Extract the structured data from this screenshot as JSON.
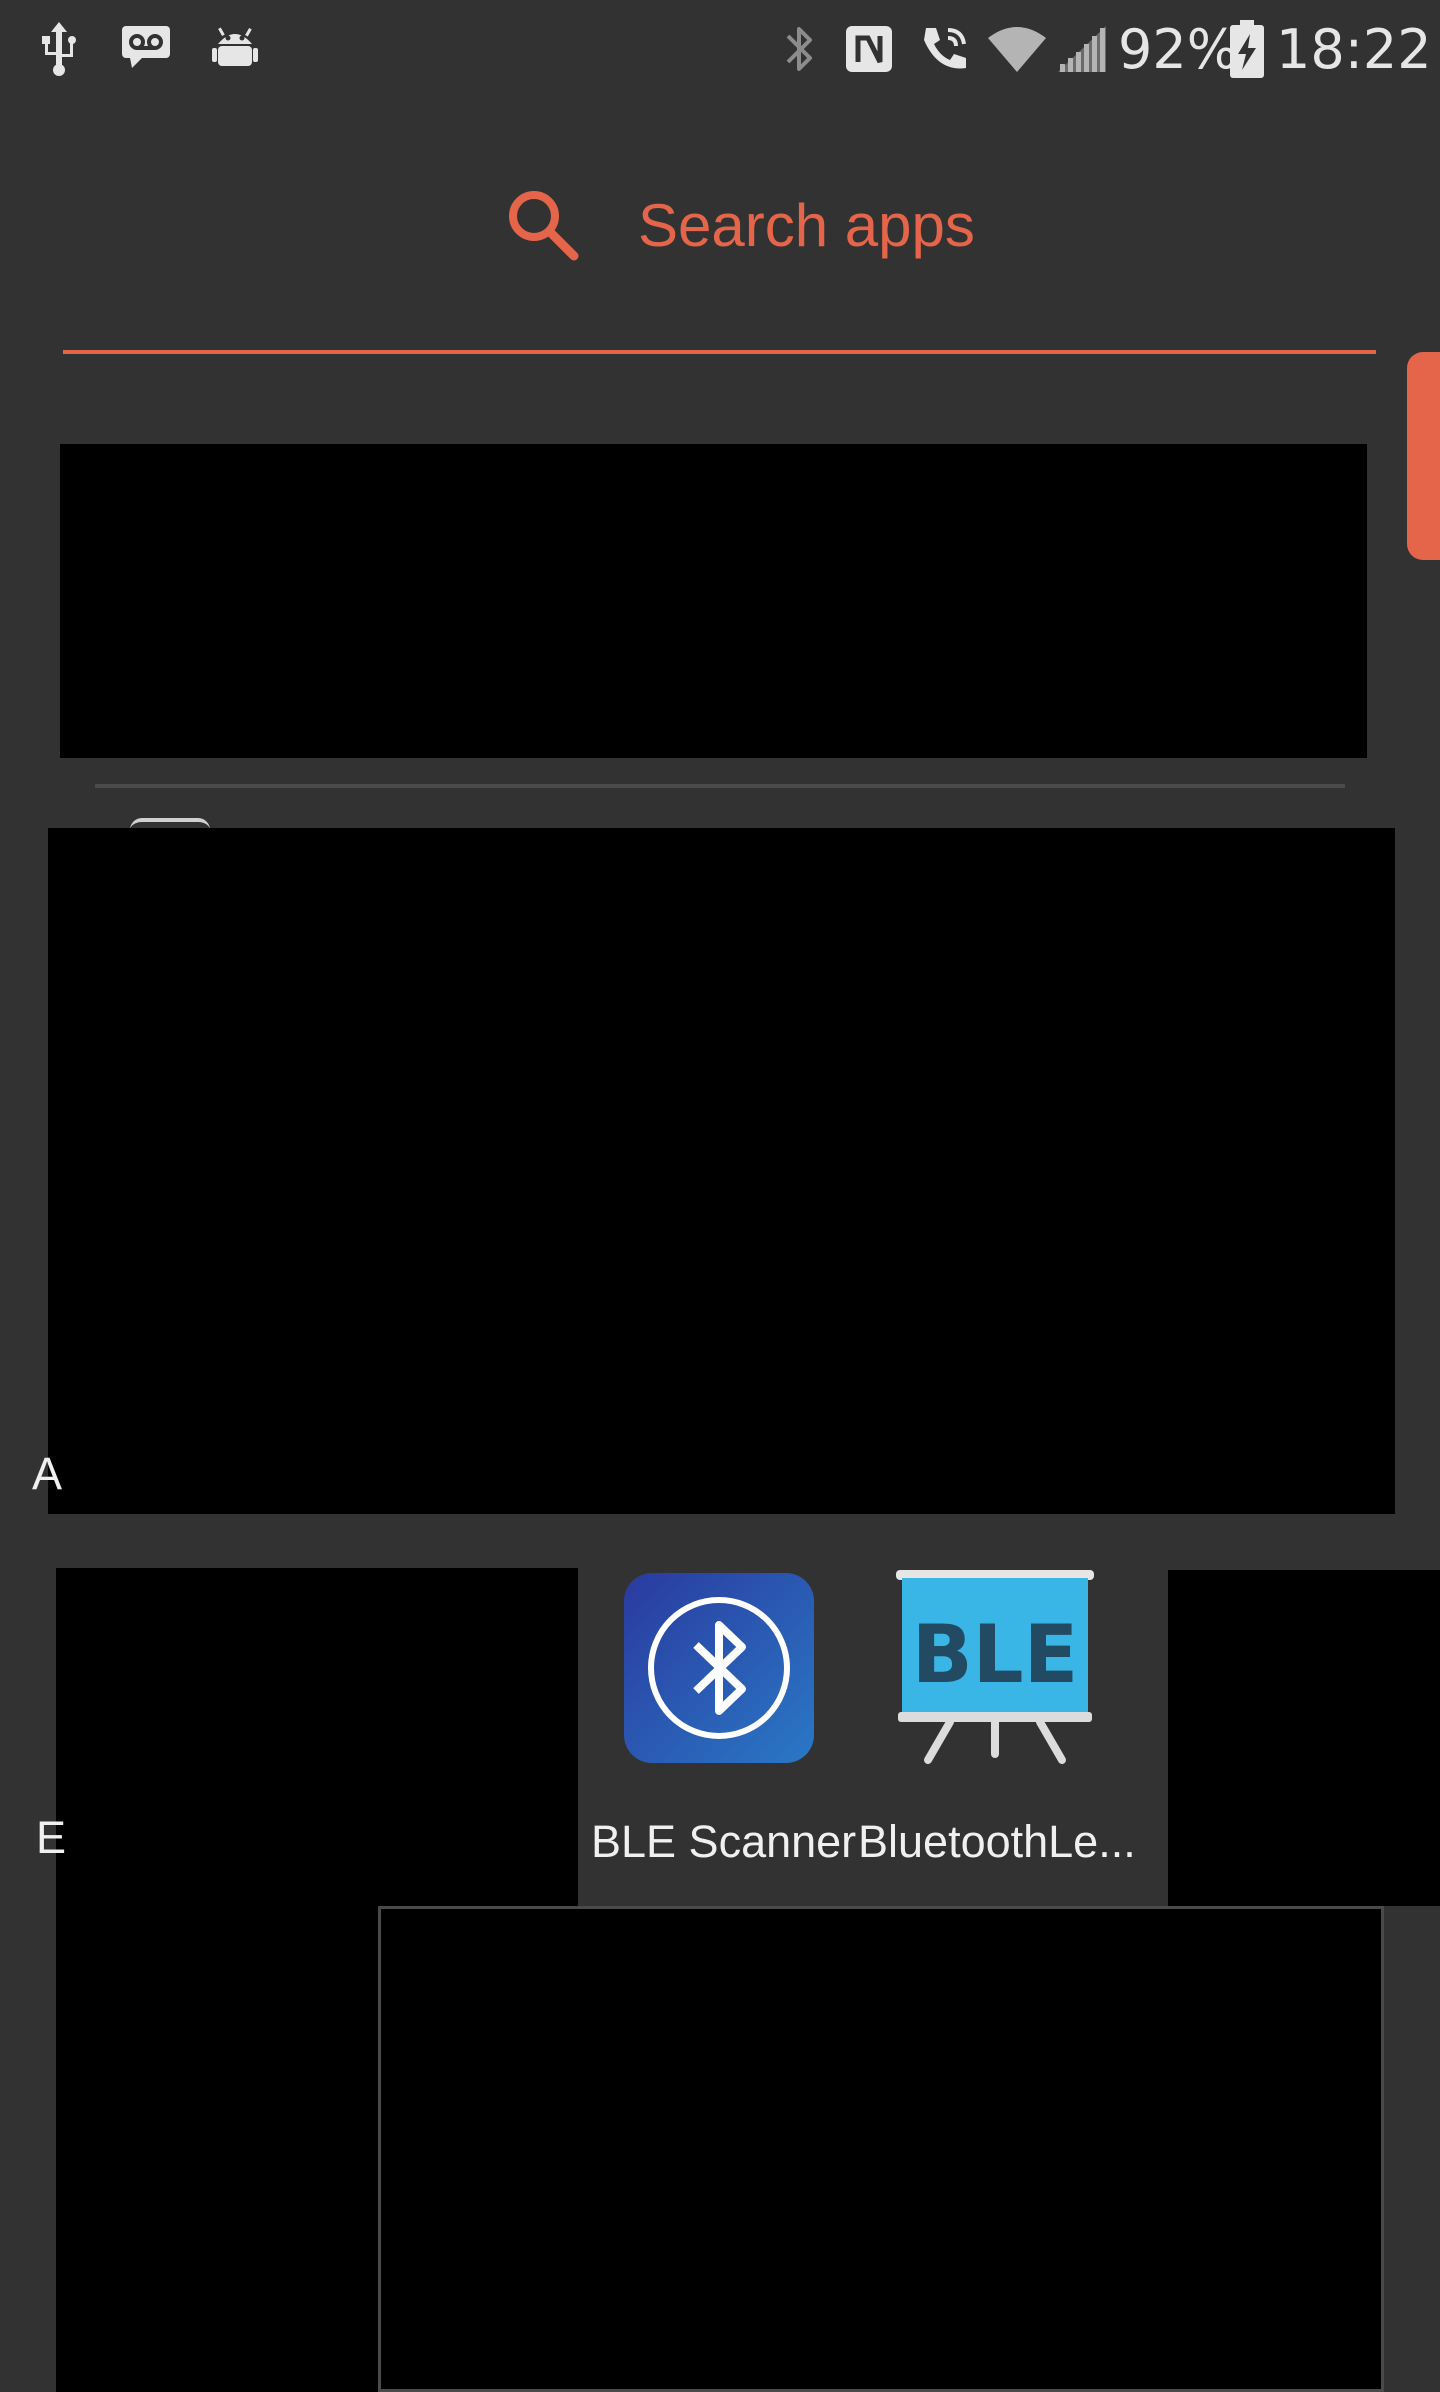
{
  "status_bar": {
    "battery_percent": "92%",
    "time": "18:22",
    "left_icons": [
      "usb-icon",
      "voicemail-icon",
      "android-debug-icon"
    ],
    "right_icons": [
      "bluetooth-icon",
      "nfc-icon",
      "wifi-calling-icon",
      "wifi-icon",
      "signal-icon",
      "battery-charging-icon"
    ]
  },
  "search": {
    "placeholder": "Search apps",
    "icon": "search-icon"
  },
  "accent_color": "#e5654a",
  "partial_labels": {
    "left_a": "A",
    "left_b": "E"
  },
  "apps": [
    {
      "label": "BLE Scanner",
      "icon": "ble-scanner-icon"
    },
    {
      "label": "BluetoothLe...",
      "icon": "bluetooth-le-icon"
    }
  ]
}
